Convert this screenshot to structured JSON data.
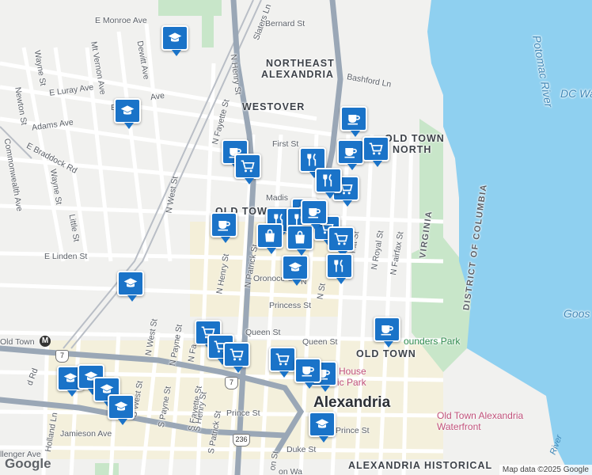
{
  "map": {
    "attribution": "Map data ©2025 Google",
    "logo": "Google",
    "colors": {
      "water": "#8fd0f0",
      "park": "#c8e6c9",
      "land": "#f1f1ef",
      "road": "#ffffff",
      "highway": "#9aa7b6",
      "rail": "#b9bec6",
      "marker": "#1a73c8",
      "commercial": "#f7efc9"
    },
    "areas": {
      "northeast": "NORTHEAST",
      "alexandria_sub": "ALEXANDRIA",
      "westover": "WESTOVER",
      "oldtown_north_1": "OLD TOWN",
      "oldtown_north_2": "NORTH",
      "oldtown_west": "OLD TOWN WEST",
      "oldtown": "OLD TOWN",
      "alexandria_historical": "ALEXANDRIA HISTORICAL"
    },
    "city": "Alexandria",
    "borders": {
      "virginia": "VIRGINIA",
      "dc": "DISTRICT OF COLUMBIA"
    },
    "water_labels": {
      "potomac": "Potomac River",
      "river2": "River",
      "dc_water": "DC Wa",
      "goose": "Goos"
    },
    "poi": {
      "park1": "House",
      "park2": "ic Park",
      "founders": "ounders Park",
      "waterfront1": "Old Town Alexandria",
      "waterfront2": "Waterfront"
    },
    "streets": {
      "monroe": "E Monroe Ave",
      "bernard": "Bernard St",
      "slaters": "Slaters Ln",
      "henry_n": "N Henry St",
      "dewitt": "Dewitt Ave",
      "mtvernon": "Mt Vernon Ave",
      "wayne": "Wayne St",
      "newton": "Newton St",
      "luray": "E Luray Ave",
      "ebar": "E",
      "ave": "Ave",
      "adams": "Adams Ave",
      "braddock": "E Braddock Rd",
      "bashford": "Bashford Ln",
      "fayette_n": "N Fayette St",
      "first": "First St",
      "commonwealth": "Commonwealth Ave",
      "wayne2": "Wayne St",
      "little": "Little St",
      "nwest": "N West St",
      "madison": "Madis",
      "elinden": "E Linden St",
      "nhenry2": "N Henry St",
      "npatrick": "N Patrick St",
      "oronoco": "Oronoco St",
      "princess": "Princess St",
      "nst": "N St",
      "npitt": "Pitt St",
      "nroyal": "N Royal St",
      "nfairfax": "N Fairfax St",
      "queen": "Queen St",
      "queen2": "Queen St",
      "nweststreet": "N West St",
      "npayne": "N Payne St",
      "nfa": "N Fa",
      "swest": "S West St",
      "spayne": "S Payne St",
      "sfayette": "S Fayette St",
      "shenry": "S Henry St",
      "spatrick": "S Patrick St",
      "prince": "Prince St",
      "prince2": "Prince St",
      "jamieson": "Jamieson Ave",
      "holland": "Holland Ln",
      "duke": "Duke St",
      "elenger": "llenger Ave",
      "onst": "on St",
      "rd": "d Rd",
      "onwa": "on Wa",
      "n": "N"
    },
    "shields": {
      "r7a": "7",
      "r7b": "7",
      "r236": "236"
    },
    "metro": {
      "station": "Old Town",
      "icon": "M"
    },
    "markers": [
      {
        "type": "school"
      },
      {
        "type": "school"
      },
      {
        "type": "school"
      },
      {
        "type": "school"
      },
      {
        "type": "school"
      },
      {
        "type": "school"
      },
      {
        "type": "school"
      },
      {
        "type": "school"
      },
      {
        "type": "school"
      },
      {
        "type": "cafe"
      },
      {
        "type": "cafe"
      },
      {
        "type": "cafe"
      },
      {
        "type": "cafe"
      },
      {
        "type": "cafe"
      },
      {
        "type": "cafe"
      },
      {
        "type": "cafe"
      },
      {
        "type": "grocery"
      },
      {
        "type": "grocery"
      },
      {
        "type": "grocery"
      },
      {
        "type": "grocery"
      },
      {
        "type": "grocery"
      },
      {
        "type": "grocery"
      },
      {
        "type": "grocery"
      },
      {
        "type": "grocery"
      },
      {
        "type": "grocery"
      },
      {
        "type": "restaurant"
      },
      {
        "type": "restaurant"
      },
      {
        "type": "restaurant"
      },
      {
        "type": "restaurant"
      },
      {
        "type": "restaurant"
      },
      {
        "type": "shopping"
      },
      {
        "type": "shopping"
      },
      {
        "type": "cafe"
      },
      {
        "type": "cafe"
      }
    ]
  }
}
